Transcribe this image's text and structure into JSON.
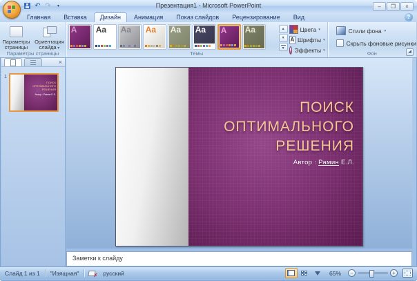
{
  "window": {
    "title": "Презентация1 - Microsoft PowerPoint",
    "controls": {
      "minimize": "–",
      "maximize": "❐",
      "close": "×"
    }
  },
  "icons": [
    "office-menu",
    "save",
    "undo",
    "redo",
    "customize-quick-access",
    "help",
    "page-setup",
    "slide-orientation",
    "theme-colors",
    "theme-fonts",
    "theme-effects",
    "background-styles",
    "hide-background-checkbox",
    "dialog-launcher",
    "slides-tab",
    "outline-tab",
    "close-pane",
    "spellcheck-book",
    "view-normal",
    "view-sorter",
    "view-slideshow",
    "zoom-out",
    "zoom-in",
    "fit-to-window"
  ],
  "tabs": {
    "active": "Дизайн",
    "items": [
      "Главная",
      "Вставка",
      "Дизайн",
      "Анимация",
      "Показ слайдов",
      "Рецензирование",
      "Вид"
    ]
  },
  "ribbon": {
    "page_setup": {
      "label": "Параметры страницы",
      "buttons": [
        {
          "label": "Параметры страницы"
        },
        {
          "label": "Ориентация слайда"
        }
      ]
    },
    "themes": {
      "label": "Темы",
      "tools": [
        {
          "label": "Цвета"
        },
        {
          "label": "Шрифты"
        },
        {
          "label": "Эффекты"
        }
      ],
      "items": [
        {
          "name": "current-purple",
          "aa": "A",
          "aa_color": "#cf9fca",
          "bg1": "#93388a",
          "bg2": "#5f1b57",
          "selected": false,
          "strip": false,
          "dots": [
            "#e39b3d",
            "#a469a0",
            "#c8574b",
            "#e39b3d",
            "#7f9cc4",
            "#caa53f"
          ]
        },
        {
          "name": "office-white",
          "aa": "Aa",
          "aa_color": "#3f3f3f",
          "bg1": "#ffffff",
          "bg2": "#ffffff",
          "selected": false,
          "strip": false,
          "dots": [
            "#1f497d",
            "#4f81bd",
            "#c0504d",
            "#9bbb59",
            "#8064a2",
            "#4bacc6"
          ]
        },
        {
          "name": "silver",
          "aa": "Aa",
          "aa_color": "#85858c",
          "bg1": "#cbccd0",
          "bg2": "#8e8e93",
          "selected": false,
          "strip": false,
          "dots": [
            "#5d6b86",
            "#7a86a3",
            "#9aa5bd",
            "#8a7ba0",
            "#a0a5b0",
            "#6f7b96"
          ]
        },
        {
          "name": "paper-light",
          "aa": "Aa",
          "aa_color": "#e0802e",
          "bg1": "#ffffff",
          "bg2": "#d8d5cd",
          "selected": false,
          "strip": false,
          "dots": [
            "#e0802e",
            "#d8b15c",
            "#b5ad97",
            "#c4bfae",
            "#8f897a",
            "#d8b15c"
          ]
        },
        {
          "name": "olive",
          "aa": "Aa",
          "aa_color": "#f4f2e8",
          "bg1": "#9aa089",
          "bg2": "#7e8468",
          "selected": false,
          "strip": false,
          "dots": [
            "#d6b60e",
            "#c27e20",
            "#9aa53f",
            "#b5a23a",
            "#8f9a4b",
            "#caa53f"
          ]
        },
        {
          "name": "dark-navy",
          "aa": "Aa",
          "aa_color": "#ffffff",
          "bg1": "#4a4a66",
          "bg2": "#33334c",
          "selected": false,
          "strip": true,
          "dots": [
            "#31598e",
            "#c0504d",
            "#9bbb59",
            "#8064a2",
            "#4bacc6",
            "#f79646"
          ]
        },
        {
          "name": "elegant-selected",
          "aa": "A",
          "aa_color": "#e59ad2",
          "bg1": "#93388a",
          "bg2": "#5f1b57",
          "selected": true,
          "strip": false,
          "dots": [
            "#e39b3d",
            "#a469a0",
            "#c8574b",
            "#e39b3d",
            "#7f9cc4",
            "#caa53f"
          ]
        },
        {
          "name": "olive-dark",
          "aa": "Aa",
          "aa_color": "#ece8d4",
          "bg1": "#7e8268",
          "bg2": "#666b52",
          "selected": false,
          "strip": false,
          "dots": [
            "#d6b60e",
            "#c27e20",
            "#9aa53f",
            "#b5a23a",
            "#8f9a4b",
            "#caa53f"
          ]
        }
      ]
    },
    "background": {
      "label": "Фон",
      "styles_button": "Стили фона",
      "hide_checkbox_label": "Скрыть фоновые рисунки",
      "hide_checked": false
    }
  },
  "slide_panel": {
    "slide_number": "1"
  },
  "slide": {
    "title_lines": [
      "ПОИСК",
      "ОПТИМАЛЬНОГО",
      "РЕШЕНИЯ"
    ],
    "author_label": "Автор :",
    "author_name": "Рамин",
    "author_suffix": "Е.Л.",
    "colors": {
      "title_text": "#f5c795",
      "bg_light": "#95478b",
      "bg_mid": "#7c3070",
      "bg_dark": "#5a1b50",
      "author_text": "#ffffff",
      "selection_orange": "#e8973f"
    }
  },
  "notes": {
    "placeholder": "Заметки к слайду"
  },
  "status_bar": {
    "slide_counter": "Слайд 1 из 1",
    "theme_name": "\"Изящная\"",
    "language": "русский",
    "zoom_level": "65%"
  }
}
